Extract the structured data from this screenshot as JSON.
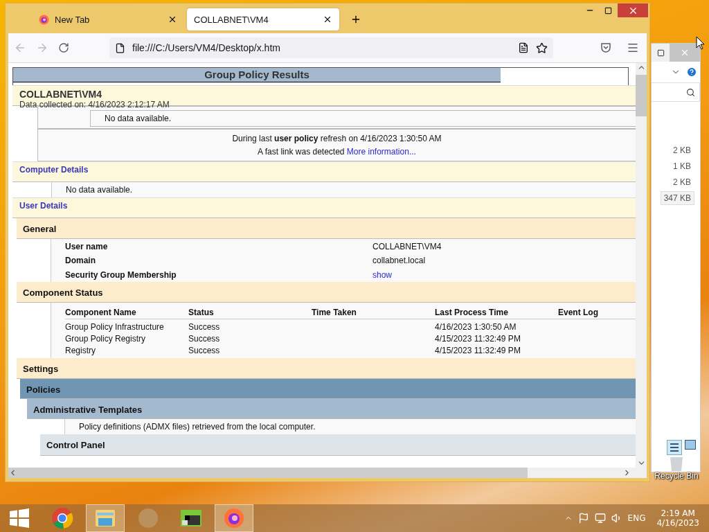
{
  "browser": {
    "tabs": [
      {
        "label": "New Tab",
        "selected": false,
        "kind": "firefox"
      },
      {
        "label": "COLLABNET\\VM4",
        "selected": true,
        "kind": "page"
      }
    ],
    "url": "file:///C:/Users/VM4/Desktop/x.htm"
  },
  "report": {
    "title": "Group Policy Results",
    "computer": "COLLABNET\\VM4",
    "collected": "Data collected on: 4/16/2023 2:12:17 AM",
    "summary_no_data": "No data available.",
    "refresh_line": "During last **user policy** refresh on 4/16/2023 1:30:50 AM",
    "fast_link": "A fast link was detected",
    "more_info": "More information...",
    "computer_details": {
      "title": "Computer Details",
      "no_data": "No data available."
    },
    "user_details": {
      "title": "User Details",
      "general": {
        "title": "General",
        "rows": [
          {
            "label": "User name",
            "value": "COLLABNET\\VM4",
            "kind": "text"
          },
          {
            "label": "Domain",
            "value": "collabnet.local",
            "kind": "text"
          },
          {
            "label": "Security Group Membership",
            "value": "show",
            "kind": "link"
          }
        ]
      },
      "component_status": {
        "title": "Component Status",
        "columns": [
          "Component Name",
          "Status",
          "Time Taken",
          "Last Process Time",
          "Event Log"
        ],
        "rows": [
          {
            "name": "Group Policy Infrastructure",
            "status": "Success",
            "last": "4/16/2023 1:30:50 AM"
          },
          {
            "name": "Group Policy Registry",
            "status": "Success",
            "last": "4/15/2023 11:32:49 PM"
          },
          {
            "name": "Registry",
            "status": "Success",
            "last": "4/15/2023 11:32:49 PM"
          }
        ]
      },
      "settings": {
        "title": "Settings",
        "policies": "Policies",
        "admin_templates": "Administrative Templates",
        "note": "Policy definitions (ADMX files) retrieved from the local computer.",
        "control_panel": "Control Panel"
      }
    }
  },
  "explorer": {
    "sizes": [
      {
        "text": "2 KB",
        "selected": false
      },
      {
        "text": "1 KB",
        "selected": false
      },
      {
        "text": "2 KB",
        "selected": false
      },
      {
        "text": "347 KB",
        "selected": true
      }
    ]
  },
  "desktop": {
    "recycle_bin": "Recycle Bin"
  },
  "taskbar": {
    "apps": [
      {
        "kind": "start",
        "active": false
      },
      {
        "kind": "chrome",
        "active": false
      },
      {
        "kind": "explorer",
        "active": true
      },
      {
        "kind": "blank",
        "active": false
      },
      {
        "kind": "terminal",
        "active": false
      },
      {
        "kind": "firefox",
        "active": true
      }
    ],
    "language": "ENG",
    "time": "2:19 AM",
    "date": "4/16/2023"
  }
}
